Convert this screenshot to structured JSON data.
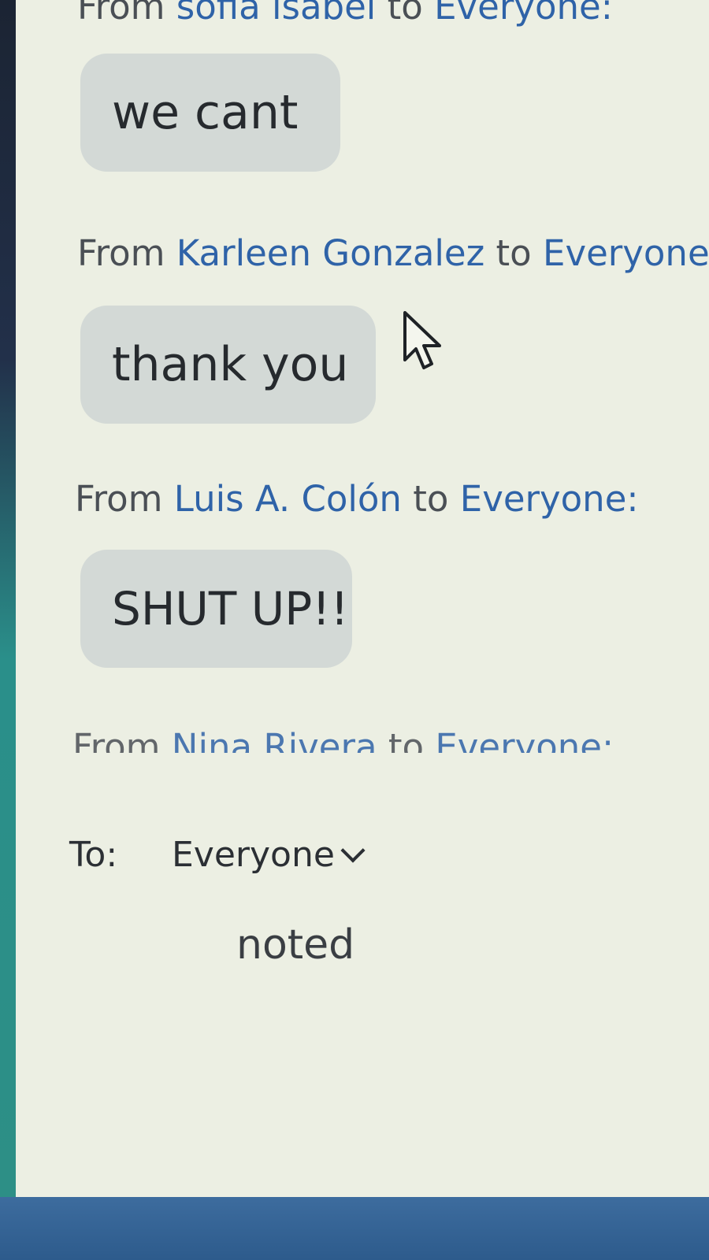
{
  "messages": [
    {
      "prefix": "From ",
      "sender": "sofia isabel",
      "middle": " to ",
      "target": "Everyone:",
      "text": "we cant"
    },
    {
      "prefix": "From ",
      "sender": "Karleen Gonzalez",
      "middle": " to ",
      "target": "Everyone:",
      "text": "thank you"
    },
    {
      "prefix": "From ",
      "sender": "Luis A. Colón",
      "middle": " to ",
      "target": "Everyone:",
      "text": "SHUT UP!!"
    }
  ],
  "partial_message": {
    "prefix": "From ",
    "sender": "Nina Rivera",
    "middle": " to ",
    "target": "Everyone:"
  },
  "recipient": {
    "label": "To:",
    "value": "Everyone"
  },
  "compose": {
    "value": "noted"
  },
  "colors": {
    "link_blue": "#2f63a8",
    "bubble": "#d3d9d6",
    "panel_bg": "#ecefe3",
    "taskbar": "#2d5b8c"
  }
}
